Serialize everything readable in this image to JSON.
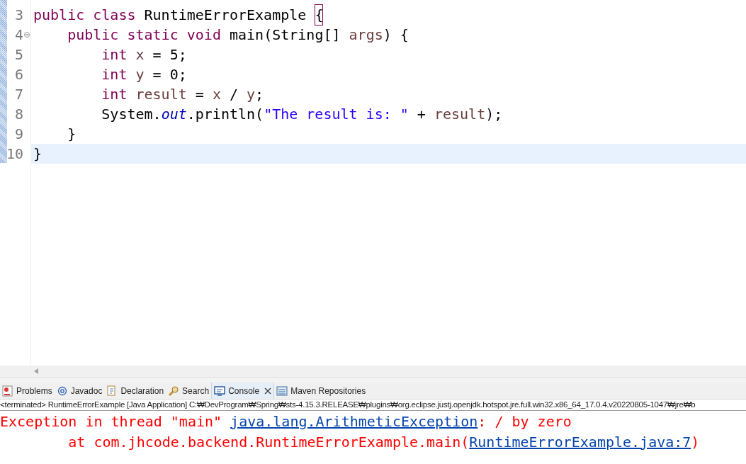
{
  "editor": {
    "lines": [
      {
        "number": "3",
        "fold": false,
        "highlighted": false,
        "tokens": [
          {
            "text": "public",
            "kind": "keyword"
          },
          {
            "text": " class",
            "kind": "keyword"
          },
          {
            "text": " RuntimeErrorExample ",
            "kind": "plain"
          },
          {
            "text": "{",
            "kind": "bracket"
          }
        ]
      },
      {
        "number": "4",
        "fold": true,
        "highlighted": false,
        "tokens": [
          {
            "text": "    public",
            "kind": "keyword"
          },
          {
            "text": " static",
            "kind": "keyword"
          },
          {
            "text": " void",
            "kind": "keyword"
          },
          {
            "text": " main(String[] ",
            "kind": "plain"
          },
          {
            "text": "args",
            "kind": "variable"
          },
          {
            "text": ") {",
            "kind": "plain"
          }
        ]
      },
      {
        "number": "5",
        "fold": false,
        "highlighted": false,
        "tokens": [
          {
            "text": "        int",
            "kind": "keyword"
          },
          {
            "text": " x",
            "kind": "variable"
          },
          {
            "text": " = 5;",
            "kind": "plain"
          }
        ]
      },
      {
        "number": "6",
        "fold": false,
        "highlighted": false,
        "tokens": [
          {
            "text": "        int",
            "kind": "keyword"
          },
          {
            "text": " y",
            "kind": "variable"
          },
          {
            "text": " = 0;",
            "kind": "plain"
          }
        ]
      },
      {
        "number": "7",
        "fold": false,
        "highlighted": false,
        "tokens": [
          {
            "text": "        int",
            "kind": "keyword"
          },
          {
            "text": " result",
            "kind": "variable"
          },
          {
            "text": " = ",
            "kind": "plain"
          },
          {
            "text": "x",
            "kind": "variable"
          },
          {
            "text": " / ",
            "kind": "plain"
          },
          {
            "text": "y",
            "kind": "variable"
          },
          {
            "text": ";",
            "kind": "plain"
          }
        ]
      },
      {
        "number": "8",
        "fold": false,
        "highlighted": false,
        "tokens": [
          {
            "text": "        System.",
            "kind": "plain"
          },
          {
            "text": "out",
            "kind": "field"
          },
          {
            "text": ".println(",
            "kind": "plain"
          },
          {
            "text": "\"The result is: \"",
            "kind": "string"
          },
          {
            "text": " + ",
            "kind": "plain"
          },
          {
            "text": "result",
            "kind": "variable"
          },
          {
            "text": ");",
            "kind": "plain"
          }
        ]
      },
      {
        "number": "9",
        "fold": false,
        "highlighted": false,
        "tokens": [
          {
            "text": "    }",
            "kind": "plain"
          }
        ]
      },
      {
        "number": "10",
        "fold": false,
        "highlighted": true,
        "tokens": [
          {
            "text": "}",
            "kind": "plain"
          }
        ]
      }
    ]
  },
  "tabs": [
    {
      "label": "Problems",
      "selected": false,
      "closable": false
    },
    {
      "label": "Javadoc",
      "selected": false,
      "closable": false
    },
    {
      "label": "Declaration",
      "selected": false,
      "closable": false
    },
    {
      "label": "Search",
      "selected": false,
      "closable": false
    },
    {
      "label": "Console",
      "selected": true,
      "closable": true
    },
    {
      "label": "Maven Repositories",
      "selected": false,
      "closable": false
    }
  ],
  "console": {
    "header": "<terminated> RuntimeErrorExample [Java Application] C:₩DevProgram₩Spring₩sts-4.15.3.RELEASE₩plugins₩org.eclipse.justj.openjdk.hotspot.jre.full.win32.x86_64_17.0.4.v20220805-1047₩jre₩b",
    "lines": [
      [
        {
          "text": "Exception in thread \"main\" ",
          "kind": "error"
        },
        {
          "text": "java.lang.ArithmeticException",
          "kind": "link"
        },
        {
          "text": ": / by zero",
          "kind": "error"
        }
      ],
      [
        {
          "text": "\tat com.jhcode.backend.RuntimeErrorExample.main(",
          "kind": "error"
        },
        {
          "text": "RuntimeErrorExample.java:7",
          "kind": "link"
        },
        {
          "text": ")",
          "kind": "error"
        }
      ]
    ]
  }
}
